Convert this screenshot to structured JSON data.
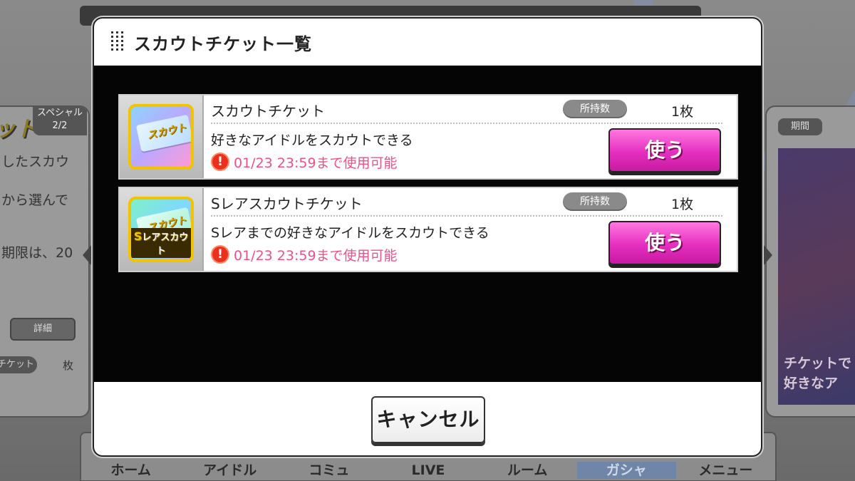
{
  "background": {
    "left_panel": {
      "tab": "スペシャル\n2/2",
      "logo": "ット",
      "lines": [
        "したスカウ",
        "から選んで",
        "期限は、20"
      ],
      "detail_button": "詳細",
      "ticket_label": "チケット",
      "unit": "枚"
    },
    "right_panel": {
      "period_label": "期間",
      "art_text": "チケットで\n好きなア"
    },
    "nav": {
      "items": [
        "ホーム",
        "アイドル",
        "コミュ",
        "LIVE",
        "ルーム",
        "ガシャ",
        "メニュー"
      ],
      "active_index": 5
    }
  },
  "modal": {
    "title": "スカウトチケット一覧",
    "cancel_label": "キャンセル",
    "tickets": [
      {
        "name": "スカウトチケット",
        "held_label": "所持数",
        "held_count": "1枚",
        "description": "好きなアイドルをスカウトできる",
        "alert_icon": "!",
        "expiry": "01/23 23:59まで使用可能",
        "use_label": "使う",
        "thumb_text": "スカウト"
      },
      {
        "name": "Sレアスカウトチケット",
        "held_label": "所持数",
        "held_count": "1枚",
        "description": "Sレアまでの好きなアイドルをスカウトできる",
        "alert_icon": "!",
        "expiry": "01/23 23:59まで使用可能",
        "use_label": "使う",
        "thumb_text": "スカウト",
        "thumb_badge_s": "S",
        "thumb_badge_rest": "レアスカウト"
      }
    ]
  },
  "colors": {
    "accent_pink": "#e52fbf",
    "expiry_text": "#f0508a",
    "alert_red": "#e8321e",
    "thumb_border": "#f2c400"
  }
}
